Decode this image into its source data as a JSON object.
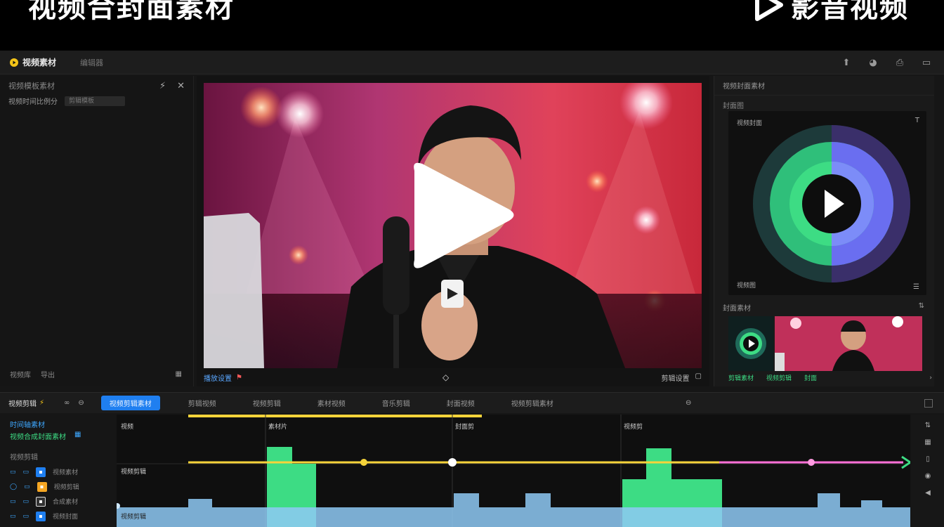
{
  "banner": {
    "title": "视频合封面素材",
    "logo_text": "影音视频"
  },
  "menubar": {
    "app_name": "视频素材",
    "menu_item": "编辑器"
  },
  "left_panel": {
    "header": "视频模板素材",
    "filter_label": "视频时间比例分",
    "filter_value": "剪辑模板",
    "footer_left": "视频库",
    "footer_right": "导出"
  },
  "preview": {
    "controls_left": "播放设置",
    "controls_right": "剪辑设置"
  },
  "right_panel": {
    "header": "视频封面素材",
    "sub_label": "封面图",
    "cover_label": "视频封面",
    "cover_bottom": "视频图",
    "thumbs_label": "封面素材",
    "thumb_btns": [
      "剪辑素材",
      "视频剪辑",
      "封面"
    ]
  },
  "timeline_toolbar": {
    "label": "视频剪辑",
    "tabs": [
      "视频剪辑素材",
      "剪辑视频",
      "视频剪辑",
      "素材视频",
      "音乐剪辑",
      "封面视频",
      "视频剪辑素材"
    ]
  },
  "timeline_left": {
    "row1": "时间轴素材",
    "row2": "视频合成封面素材",
    "row3": "视频剪辑",
    "tracks": [
      {
        "name": "视频素材",
        "color": "#3ea8ff"
      },
      {
        "name": "视频剪辑",
        "color": "#f5a623"
      },
      {
        "name": "合成素材",
        "color": "#dddddd"
      },
      {
        "name": "视频封面",
        "color": "#3ea8ff"
      }
    ]
  },
  "timeline": {
    "clip_labels": [
      "视频",
      "素材片",
      "封面剪",
      "视频剪",
      "视频剪辑",
      "视频剪辑"
    ],
    "colors": {
      "yellow": "#f5d33a",
      "green": "#3ddc84",
      "pink": "#ff6fd8",
      "blue": "#8ec9f5"
    }
  },
  "colors": {
    "accent_blue": "#1f7ff0",
    "accent_green": "#3ddc84",
    "panel_bg": "#161616"
  }
}
